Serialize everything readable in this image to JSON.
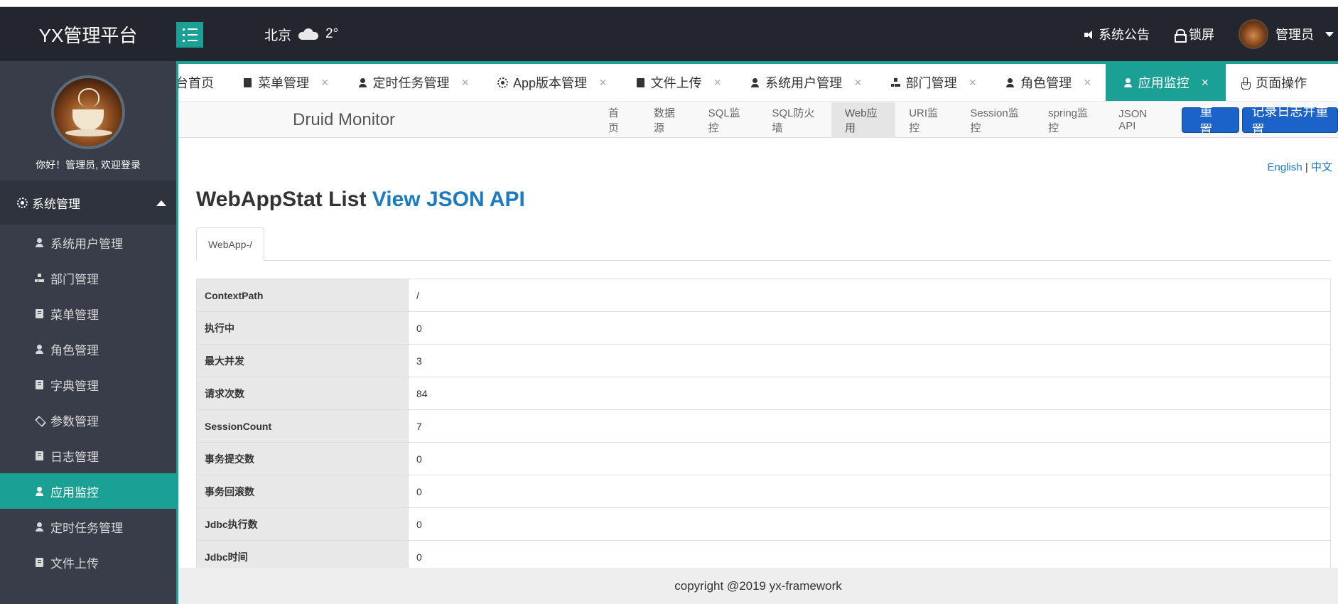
{
  "header": {
    "brand": "YX管理平台",
    "weather": {
      "city": "北京",
      "temp": "2°",
      "icon": "cloud-icon"
    },
    "notice_label": "系统公告",
    "lock_label": "锁屏",
    "user_label": "管理员"
  },
  "sidebar": {
    "greeting": "你好！管理员, 欢迎登录",
    "group_label": "系统管理",
    "items": [
      {
        "label": "系统用户管理",
        "icon": "user-icon"
      },
      {
        "label": "部门管理",
        "icon": "sitemap-icon"
      },
      {
        "label": "菜单管理",
        "icon": "document-icon"
      },
      {
        "label": "角色管理",
        "icon": "user-lock-icon"
      },
      {
        "label": "字典管理",
        "icon": "document-icon"
      },
      {
        "label": "参数管理",
        "icon": "layers-icon"
      },
      {
        "label": "日志管理",
        "icon": "document-icon"
      },
      {
        "label": "应用监控",
        "icon": "user-lock-icon"
      },
      {
        "label": "定时任务管理",
        "icon": "user-lock-icon"
      },
      {
        "label": "文件上传",
        "icon": "document-icon"
      }
    ],
    "active_item": "应用监控"
  },
  "tabs": [
    {
      "label": "台首页"
    },
    {
      "label": "菜单管理"
    },
    {
      "label": "定时任务管理"
    },
    {
      "label": "App版本管理"
    },
    {
      "label": "文件上传"
    },
    {
      "label": "系统用户管理"
    },
    {
      "label": "部门管理"
    },
    {
      "label": "角色管理"
    },
    {
      "label": "应用监控"
    },
    {
      "label": "页面操作"
    }
  ],
  "tab_close_glyph": "×",
  "druid": {
    "brand": "Druid Monitor",
    "links": [
      "首页",
      "数据源",
      "SQL监控",
      "SQL防火墙",
      "Web应用",
      "URI监控",
      "Session监控",
      "spring监控",
      "JSON API"
    ],
    "active_link": "Web应用",
    "reset_button": "重置",
    "log_reset_button": "记录日志并重置"
  },
  "content": {
    "lang_en": "English",
    "lang_sep": "|",
    "lang_zh": "中文",
    "title": "WebAppStat List",
    "title_link": "View JSON API",
    "webapp_tab": "WebApp-/",
    "rows": [
      {
        "key": "ContextPath",
        "value": "/"
      },
      {
        "key": "执行中",
        "value": "0"
      },
      {
        "key": "最大并发",
        "value": "3"
      },
      {
        "key": "请求次数",
        "value": "84"
      },
      {
        "key": "SessionCount",
        "value": "7"
      },
      {
        "key": "事务提交数",
        "value": "0"
      },
      {
        "key": "事务回滚数",
        "value": "0"
      },
      {
        "key": "Jdbc执行数",
        "value": "0"
      },
      {
        "key": "Jdbc时间",
        "value": "0"
      }
    ]
  },
  "footer": {
    "text": "copyright @2019 yx-framework"
  },
  "colors": {
    "accent": "#1aa094",
    "header_bg": "#23262e",
    "sidebar_bg": "#393d49",
    "button_blue": "#1b63c9",
    "link_blue": "#1a7bc4"
  }
}
